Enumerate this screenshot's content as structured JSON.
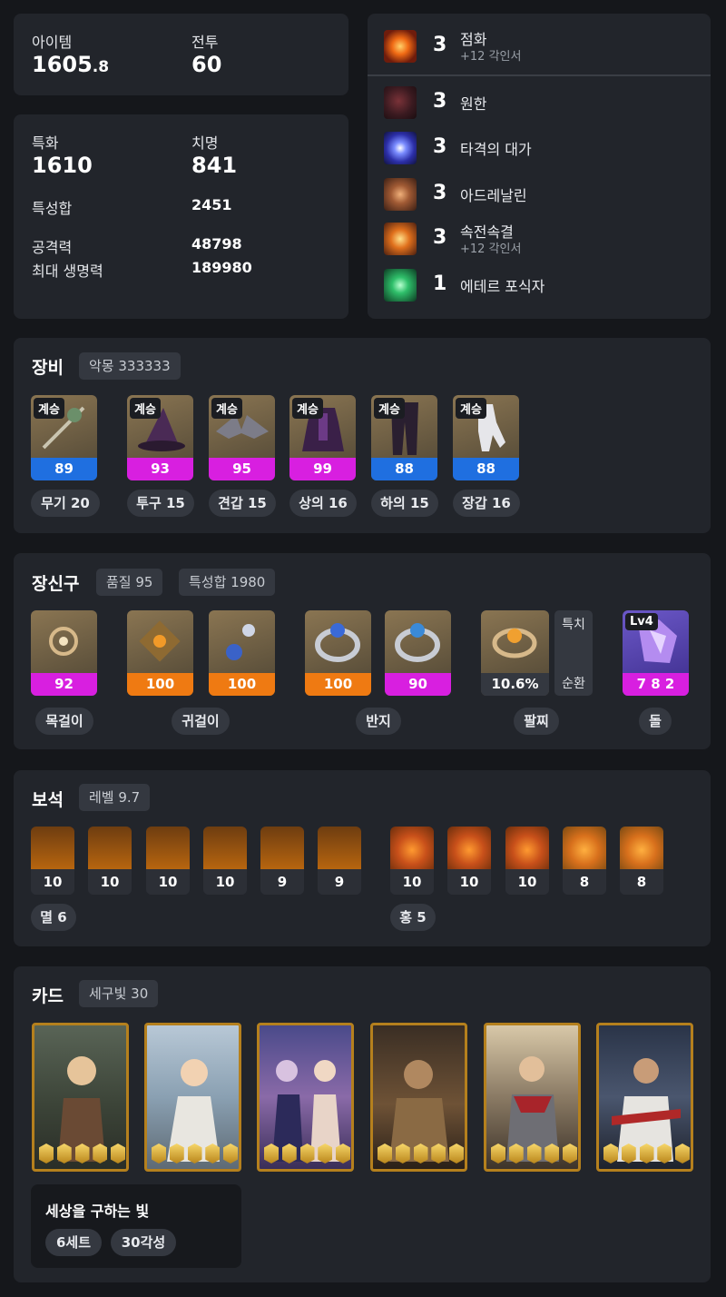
{
  "summary": {
    "item_label": "아이템",
    "item_value_main": "1605",
    "item_value_decimal": ".8",
    "combat_label": "전투",
    "combat_value": "60"
  },
  "stats": {
    "spec_label": "특화",
    "spec_value": "1610",
    "crit_label": "치명",
    "crit_value": "841",
    "total_label": "특성합",
    "total_value": "2451",
    "atk_label": "공격력",
    "atk_value": "48798",
    "hp_label": "최대 생명력",
    "hp_value": "189980"
  },
  "engravings": [
    {
      "level": "3",
      "name": "점화",
      "sub": "+12 각인서",
      "icon": "ignite-icon"
    },
    {
      "level": "3",
      "name": "원한",
      "sub": "",
      "icon": "grudge-icon"
    },
    {
      "level": "3",
      "name": "타격의 대가",
      "sub": "",
      "icon": "hit-master-icon"
    },
    {
      "level": "3",
      "name": "아드레날린",
      "sub": "",
      "icon": "adrenaline-icon"
    },
    {
      "level": "3",
      "name": "속전속결",
      "sub": "+12 각인서",
      "icon": "all-out-attack-icon"
    },
    {
      "level": "1",
      "name": "에테르 포식자",
      "sub": "",
      "icon": "ether-predator-icon"
    }
  ],
  "equipment": {
    "title": "장비",
    "chip": "악몽 333333",
    "items": [
      {
        "tag": "계승",
        "quality": "89",
        "label": "무기 20",
        "bar": "#1f6fe0",
        "icon": "weapon-icon"
      },
      {
        "tag": "계승",
        "quality": "93",
        "label": "투구 15",
        "bar": "#d81fe0",
        "icon": "helmet-icon"
      },
      {
        "tag": "계승",
        "quality": "95",
        "label": "견갑 15",
        "bar": "#d81fe0",
        "icon": "shoulder-icon"
      },
      {
        "tag": "계승",
        "quality": "99",
        "label": "상의 16",
        "bar": "#d81fe0",
        "icon": "chest-icon"
      },
      {
        "tag": "계승",
        "quality": "88",
        "label": "하의 15",
        "bar": "#1f6fe0",
        "icon": "pants-icon"
      },
      {
        "tag": "계승",
        "quality": "88",
        "label": "장갑 16",
        "bar": "#1f6fe0",
        "icon": "gloves-icon"
      }
    ]
  },
  "accessories": {
    "title": "장신구",
    "chip_quality": "품질 95",
    "chip_total": "특성합 1980",
    "tiles": [
      {
        "value": "92",
        "bar": "#d81fe0",
        "icon": "necklace-icon"
      },
      {
        "value": "100",
        "bar": "#ef7a12",
        "icon": "earring-icon"
      },
      {
        "value": "100",
        "bar": "#ef7a12",
        "icon": "earring-icon"
      },
      {
        "value": "100",
        "bar": "#ef7a12",
        "icon": "ring-icon"
      },
      {
        "value": "90",
        "bar": "#d81fe0",
        "icon": "ring-icon"
      }
    ],
    "bracelet_value": "10.6%",
    "bracelet_stat1": "특치",
    "bracelet_stat2": "순환",
    "stone_level": "Lv4",
    "stone_value": "7 8 2",
    "labels": {
      "necklace": "목걸이",
      "earring": "귀걸이",
      "ring": "반지",
      "bracelet": "팔찌",
      "stone": "돌"
    }
  },
  "gems": {
    "title": "보석",
    "chip": "레벨 9.7",
    "left": [
      "10",
      "10",
      "10",
      "10",
      "9",
      "9"
    ],
    "right": [
      "10",
      "10",
      "10",
      "8",
      "8"
    ],
    "left_label": "멸 6",
    "right_label": "홍 5"
  },
  "cards": {
    "title": "카드",
    "chip": "세구빛 30",
    "count": 6,
    "set_name": "세상을 구하는 빛",
    "set_pill1": "6세트",
    "set_pill2": "30각성"
  }
}
